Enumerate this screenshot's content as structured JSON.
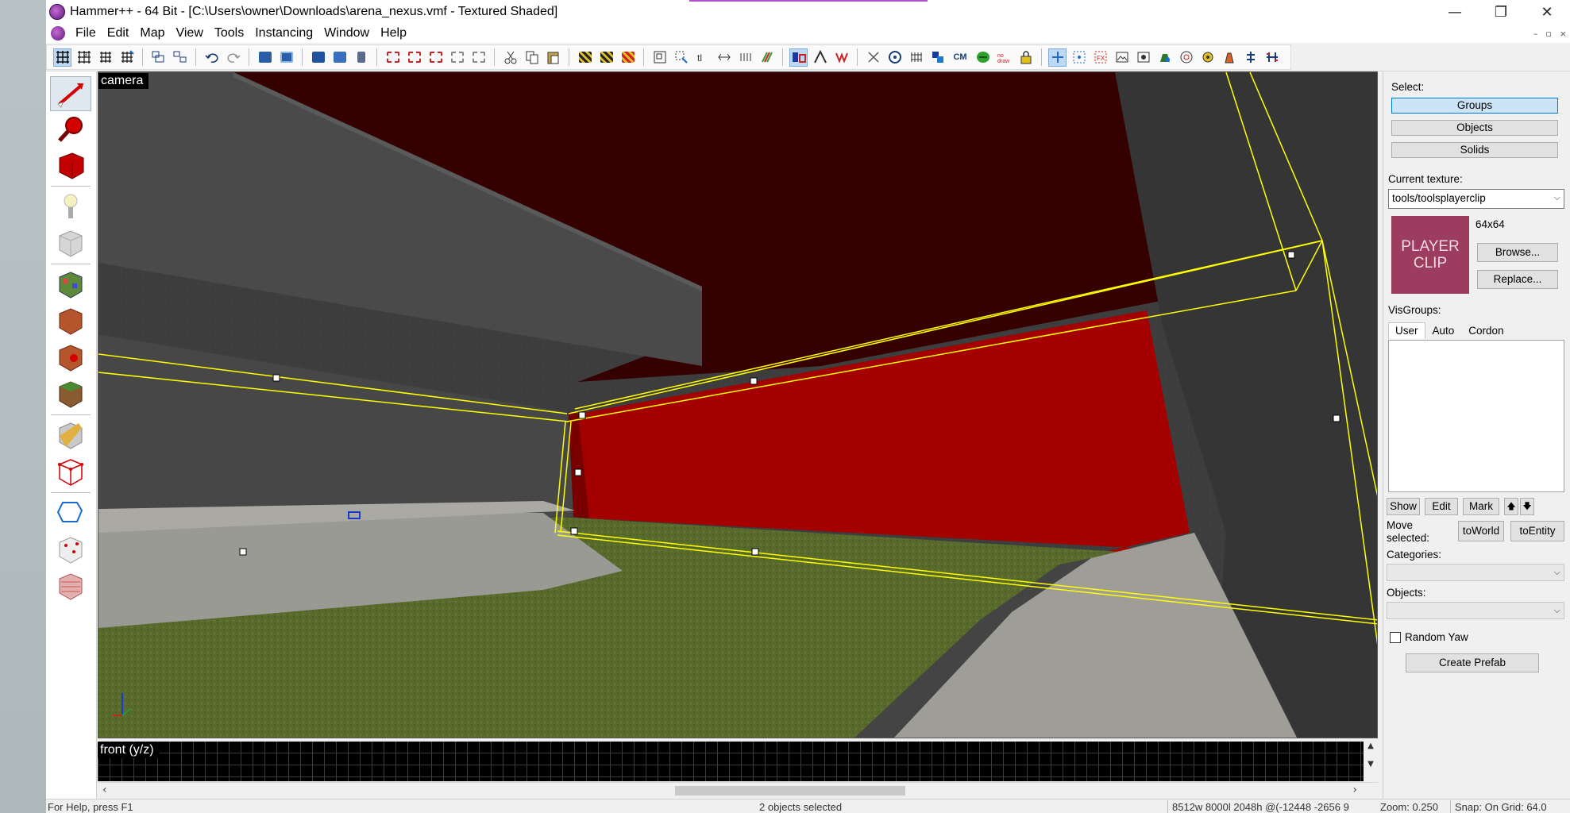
{
  "window": {
    "title": "Hammer++ - 64 Bit - [C:\\Users\\owner\\Downloads\\arena_nexus.vmf - Textured Shaded]",
    "controls": {
      "minimize": "—",
      "restore": "❐",
      "close": "✕"
    },
    "mdi_controls": {
      "minimize": "–",
      "restore": "▫",
      "close": "×"
    }
  },
  "menu": [
    "File",
    "Edit",
    "Map",
    "View",
    "Tools",
    "Instancing",
    "Window",
    "Help"
  ],
  "toolbar": {
    "cordon_label": "CM",
    "icons": [
      "grid-toggle-icon",
      "grid-3d-icon",
      "grid-smaller-icon",
      "grid-larger-icon",
      "group-icon",
      "ungroup-icon",
      "undo-icon",
      "redo-icon",
      "carve-icon",
      "hollow-icon",
      "entity-icon",
      "texture-app-icon",
      "toggle-texture-lock-icon",
      "cut-icon",
      "copy-icon",
      "paste-icon",
      "hide-icon",
      "unhide-icon",
      "quick-hide-icon",
      "cordon-icon"
    ]
  },
  "left_tools": [
    "selection-tool-icon",
    "magnify-tool-icon",
    "camera-tool-icon",
    "entity-tool-icon",
    "block-tool-icon",
    "texture-application-icon",
    "apply-texture-icon",
    "decal-tool-icon",
    "overlay-tool-icon",
    "clipping-tool-icon",
    "vertex-tool-icon",
    "path-tool-icon",
    "sprinkle-tool-icon",
    "cordon-tool-icon"
  ],
  "viewport3d": {
    "label": "camera"
  },
  "viewport2d": {
    "label": "front (y/z)"
  },
  "status": {
    "help": "For Help, press F1",
    "selection": "2 objects selected",
    "size": "8512w 8000l 2048h @(-12448 -2656 9",
    "zoom": "Zoom: 0.250",
    "snap": "Snap: On Grid: 64.0"
  },
  "panel": {
    "select_label": "Select:",
    "select_buttons": [
      "Groups",
      "Objects",
      "Solids"
    ],
    "current_texture_label": "Current texture:",
    "current_texture": "tools/toolsplayerclip",
    "texture_size": "64x64",
    "texture_preview_text": [
      "PLAYER",
      "CLIP"
    ],
    "browse": "Browse...",
    "replace": "Replace...",
    "visgroups_label": "VisGroups:",
    "tabs": [
      "User",
      "Auto",
      "Cordon"
    ],
    "show": "Show",
    "edit": "Edit",
    "mark": "Mark",
    "up": "🡅",
    "down": "🡇",
    "move_selected": "Move selected:",
    "to_world": "toWorld",
    "to_entity": "toEntity",
    "categories_label": "Categories:",
    "objects_label": "Objects:",
    "random_yaw": "Random Yaw",
    "create_prefab": "Create Prefab"
  },
  "colors": {
    "selection_outline": "#ffff00",
    "selected_face": "#a60000",
    "ceiling": "#3a0000",
    "grass": "#586a2a",
    "concrete": "#9c9c96"
  }
}
